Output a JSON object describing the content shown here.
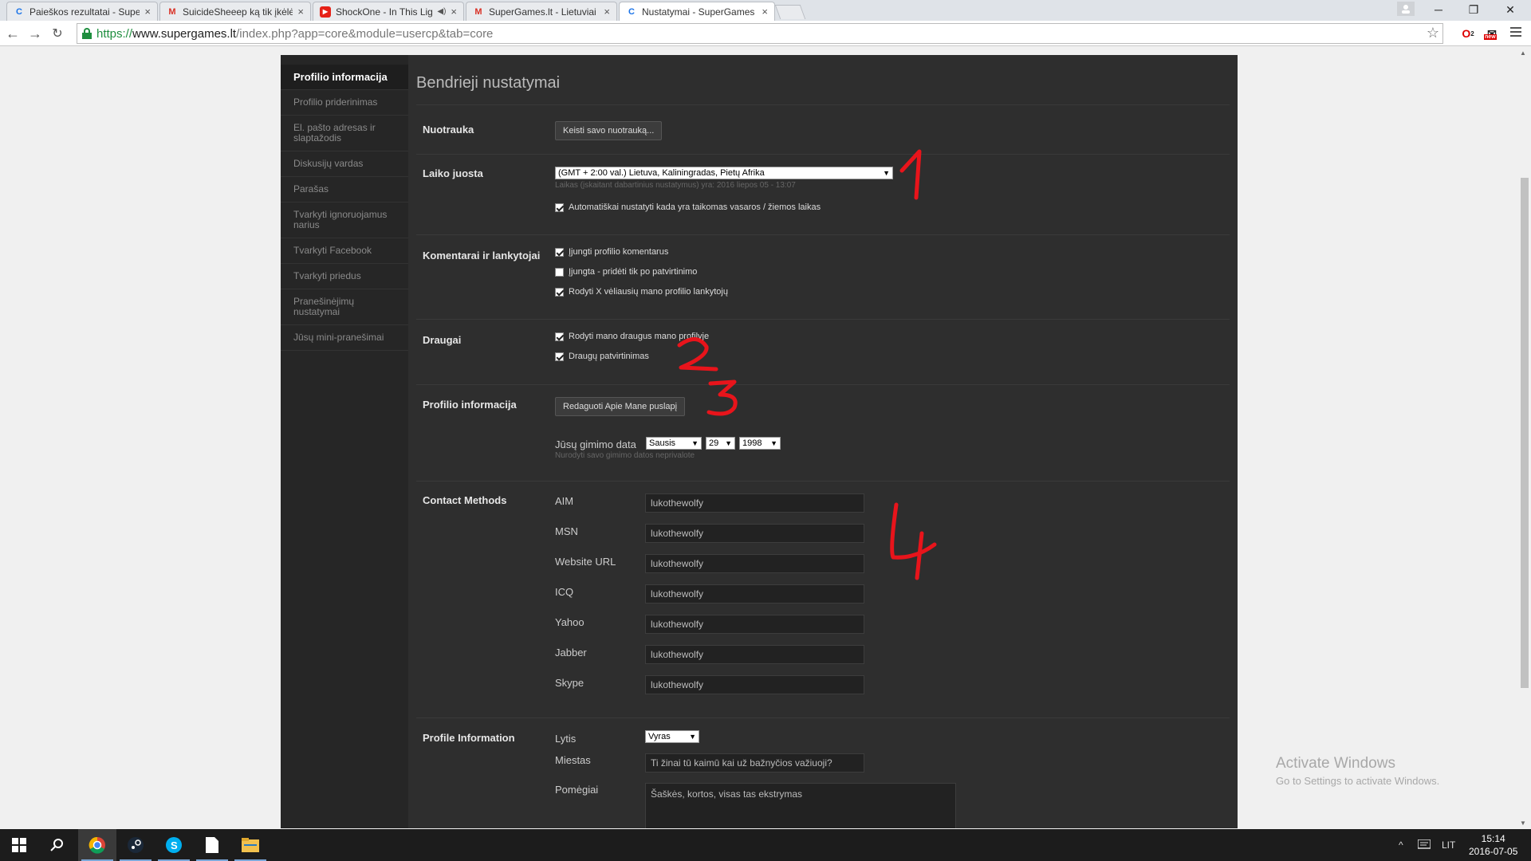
{
  "browser": {
    "tabs": [
      {
        "title": "Paieškos rezultatai - Super",
        "favicon": "c-logo-icon"
      },
      {
        "title": "SuicideSheeep ką tik įkėlė",
        "favicon": "gmail-icon"
      },
      {
        "title": "ShockOne - In This Lig",
        "favicon": "youtube-icon"
      },
      {
        "title": "SuperGames.lt - Lietuviai",
        "favicon": "gmail-icon"
      },
      {
        "title": "Nustatymai - SuperGames",
        "favicon": "c-logo-icon"
      }
    ],
    "url": {
      "scheme": "https://",
      "host": "www.supergames.lt",
      "path": "/index.php?app=core&module=usercp&tab=core"
    },
    "extension_badge": "2",
    "new_badge": "new"
  },
  "sidebar": {
    "items": [
      {
        "label": "Profilio informacija",
        "active": true
      },
      {
        "label": "Profilio priderinimas"
      },
      {
        "label": "El. pašto adresas ir slaptažodis"
      },
      {
        "label": "Diskusijų vardas"
      },
      {
        "label": "Parašas"
      },
      {
        "label": "Tvarkyti ignoruojamus narius"
      },
      {
        "label": "Tvarkyti Facebook"
      },
      {
        "label": "Tvarkyti priedus"
      },
      {
        "label": "Pranešinėjimų nustatymai"
      },
      {
        "label": "Jūsų mini-pranešimai"
      }
    ]
  },
  "main": {
    "title": "Bendrieji nustatymai",
    "photo": {
      "label": "Nuotrauka",
      "button": "Keisti savo nuotrauką..."
    },
    "timezone": {
      "label": "Laiko juosta",
      "value": "(GMT + 2:00 val.) Lietuva, Kaliningradas, Pietų Afrika",
      "hint": "Laikas (įskaitant dabartinius nustatymus) yra: 2016 liepos 05 - 13:07",
      "auto_dst": {
        "label": "Automatiškai nustatyti kada yra taikomas vasaros / žiemos laikas",
        "checked": true
      }
    },
    "comments": {
      "label": "Komentarai ir lankytojai",
      "options": [
        {
          "label": "Įjungti profilio komentarus",
          "checked": true
        },
        {
          "label": "Įjungta - pridėti tik po patvirtinimo",
          "checked": false
        },
        {
          "label": "Rodyti X vėliausių mano profilio lankytojų",
          "checked": true
        }
      ]
    },
    "friends": {
      "label": "Draugai",
      "options": [
        {
          "label": "Rodyti mano draugus mano profilyje",
          "checked": true
        },
        {
          "label": "Draugų patvirtinimas",
          "checked": true
        }
      ]
    },
    "profile_info": {
      "label": "Profilio informacija",
      "button": "Redaguoti Apie Mane puslapį",
      "birthday_label": "Jūsų gimimo data",
      "month": "Sausis",
      "day": "29",
      "year": "1998",
      "birthday_hint": "Nurodyti savo gimimo datos neprivalote"
    },
    "contact": {
      "label": "Contact Methods",
      "fields": [
        {
          "label": "AIM",
          "value": "lukothewolfy"
        },
        {
          "label": "MSN",
          "value": "lukothewolfy"
        },
        {
          "label": "Website URL",
          "value": "lukothewolfy"
        },
        {
          "label": "ICQ",
          "value": "lukothewolfy"
        },
        {
          "label": "Yahoo",
          "value": "lukothewolfy"
        },
        {
          "label": "Jabber",
          "value": "lukothewolfy"
        },
        {
          "label": "Skype",
          "value": "lukothewolfy"
        }
      ]
    },
    "profile_information": {
      "label": "Profile Information",
      "gender_label": "Lytis",
      "gender_value": "Vyras",
      "city_label": "Miestas",
      "city_value": "Ti žinai tū kaimū kai už bažnyčios važiuoji?",
      "hobbies_label": "Pomėgiai",
      "hobbies_value": "Šaškės, kortos, visas tas ekstrymas"
    }
  },
  "annotations": [
    "1",
    "2",
    "3",
    "4"
  ],
  "watermark": {
    "title": "Activate Windows",
    "subtitle": "Go to Settings to activate Windows."
  },
  "taskbar": {
    "language": "LIT",
    "time": "15:14",
    "date": "2016-07-05"
  },
  "colors": {
    "accent_green": "#1e8e3e",
    "annotation_red": "#e8141b",
    "panel": "#2e2e2e"
  }
}
